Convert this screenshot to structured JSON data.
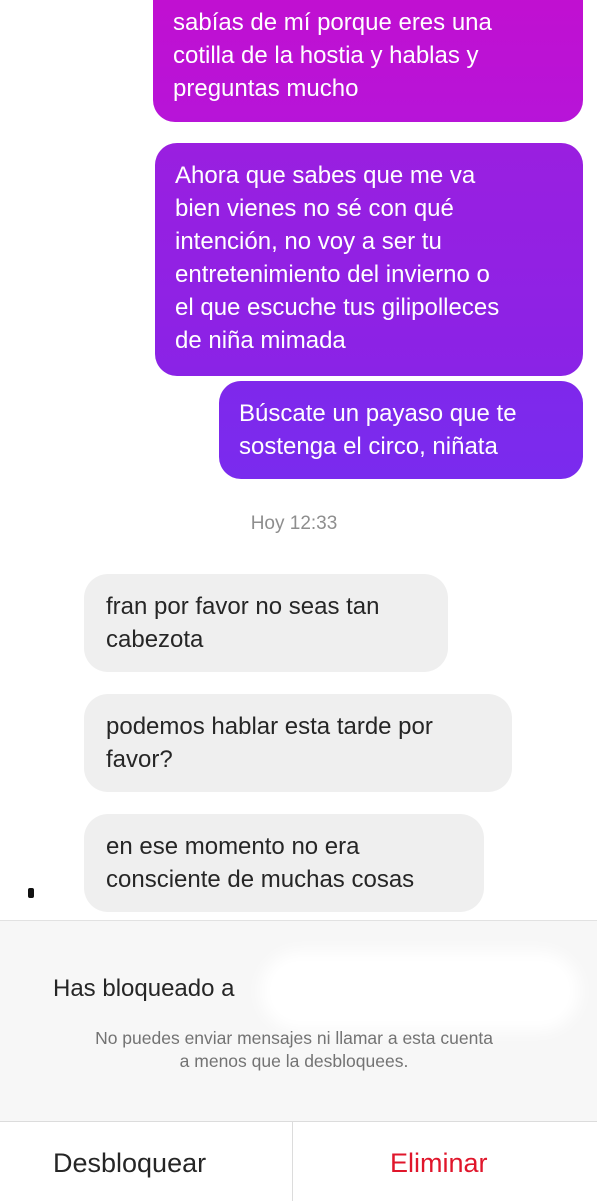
{
  "conversation": {
    "sent_messages": [
      "sabías de mí porque eres una\ncotilla de la hostia y hablas y\npreguntas mucho",
      "Ahora que sabes que me va\nbien vienes no sé con qué\nintención, no voy a ser tu\nentretenimiento del invierno o\nel que escuche tus gilipolleces\nde niña mimada",
      "Búscate un payaso que te\nsostenga el circo, niñata"
    ],
    "timestamp": "Hoy 12:33",
    "received_messages": [
      "fran por favor no seas tan\ncabezota",
      "podemos hablar esta tarde por\nfavor?",
      "en ese momento no era\nconsciente de muchas cosas"
    ]
  },
  "blocked_notice": {
    "title": "Has bloqueado a",
    "description": "No puedes enviar mensajes ni llamar a esta cuenta\na menos que la desbloquees."
  },
  "actions": {
    "unblock_label": "Desbloquear",
    "delete_label": "Eliminar"
  },
  "colors": {
    "sent_gradient_top": "#c30fcf",
    "sent_gradient_bottom": "#7a2bee",
    "received_bubble": "#efefef",
    "delete_red": "#e0162b"
  }
}
